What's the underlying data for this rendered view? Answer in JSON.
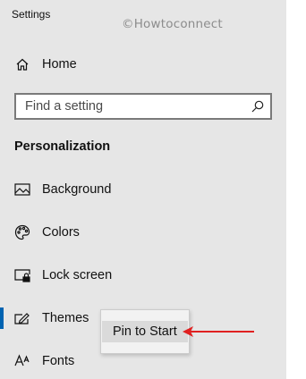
{
  "window": {
    "title": "Settings"
  },
  "watermark": "©Howtoconnect",
  "home": {
    "label": "Home",
    "icon": "home-icon"
  },
  "search": {
    "placeholder": "Find a setting",
    "value": "",
    "icon": "search-icon"
  },
  "section": {
    "title": "Personalization"
  },
  "nav_items": [
    {
      "label": "Background",
      "icon": "picture-icon",
      "active": false
    },
    {
      "label": "Colors",
      "icon": "palette-icon",
      "active": false
    },
    {
      "label": "Lock screen",
      "icon": "lock-screen-icon",
      "active": false
    },
    {
      "label": "Themes",
      "icon": "themes-icon",
      "active": true
    },
    {
      "label": "Fonts",
      "icon": "fonts-icon",
      "active": false
    }
  ],
  "context_menu": {
    "items": [
      {
        "label": "Pin to Start"
      }
    ]
  },
  "colors": {
    "sidebar_bg": "#e6e6e6",
    "accent": "#0063b1",
    "annotation_arrow": "#e02020"
  }
}
